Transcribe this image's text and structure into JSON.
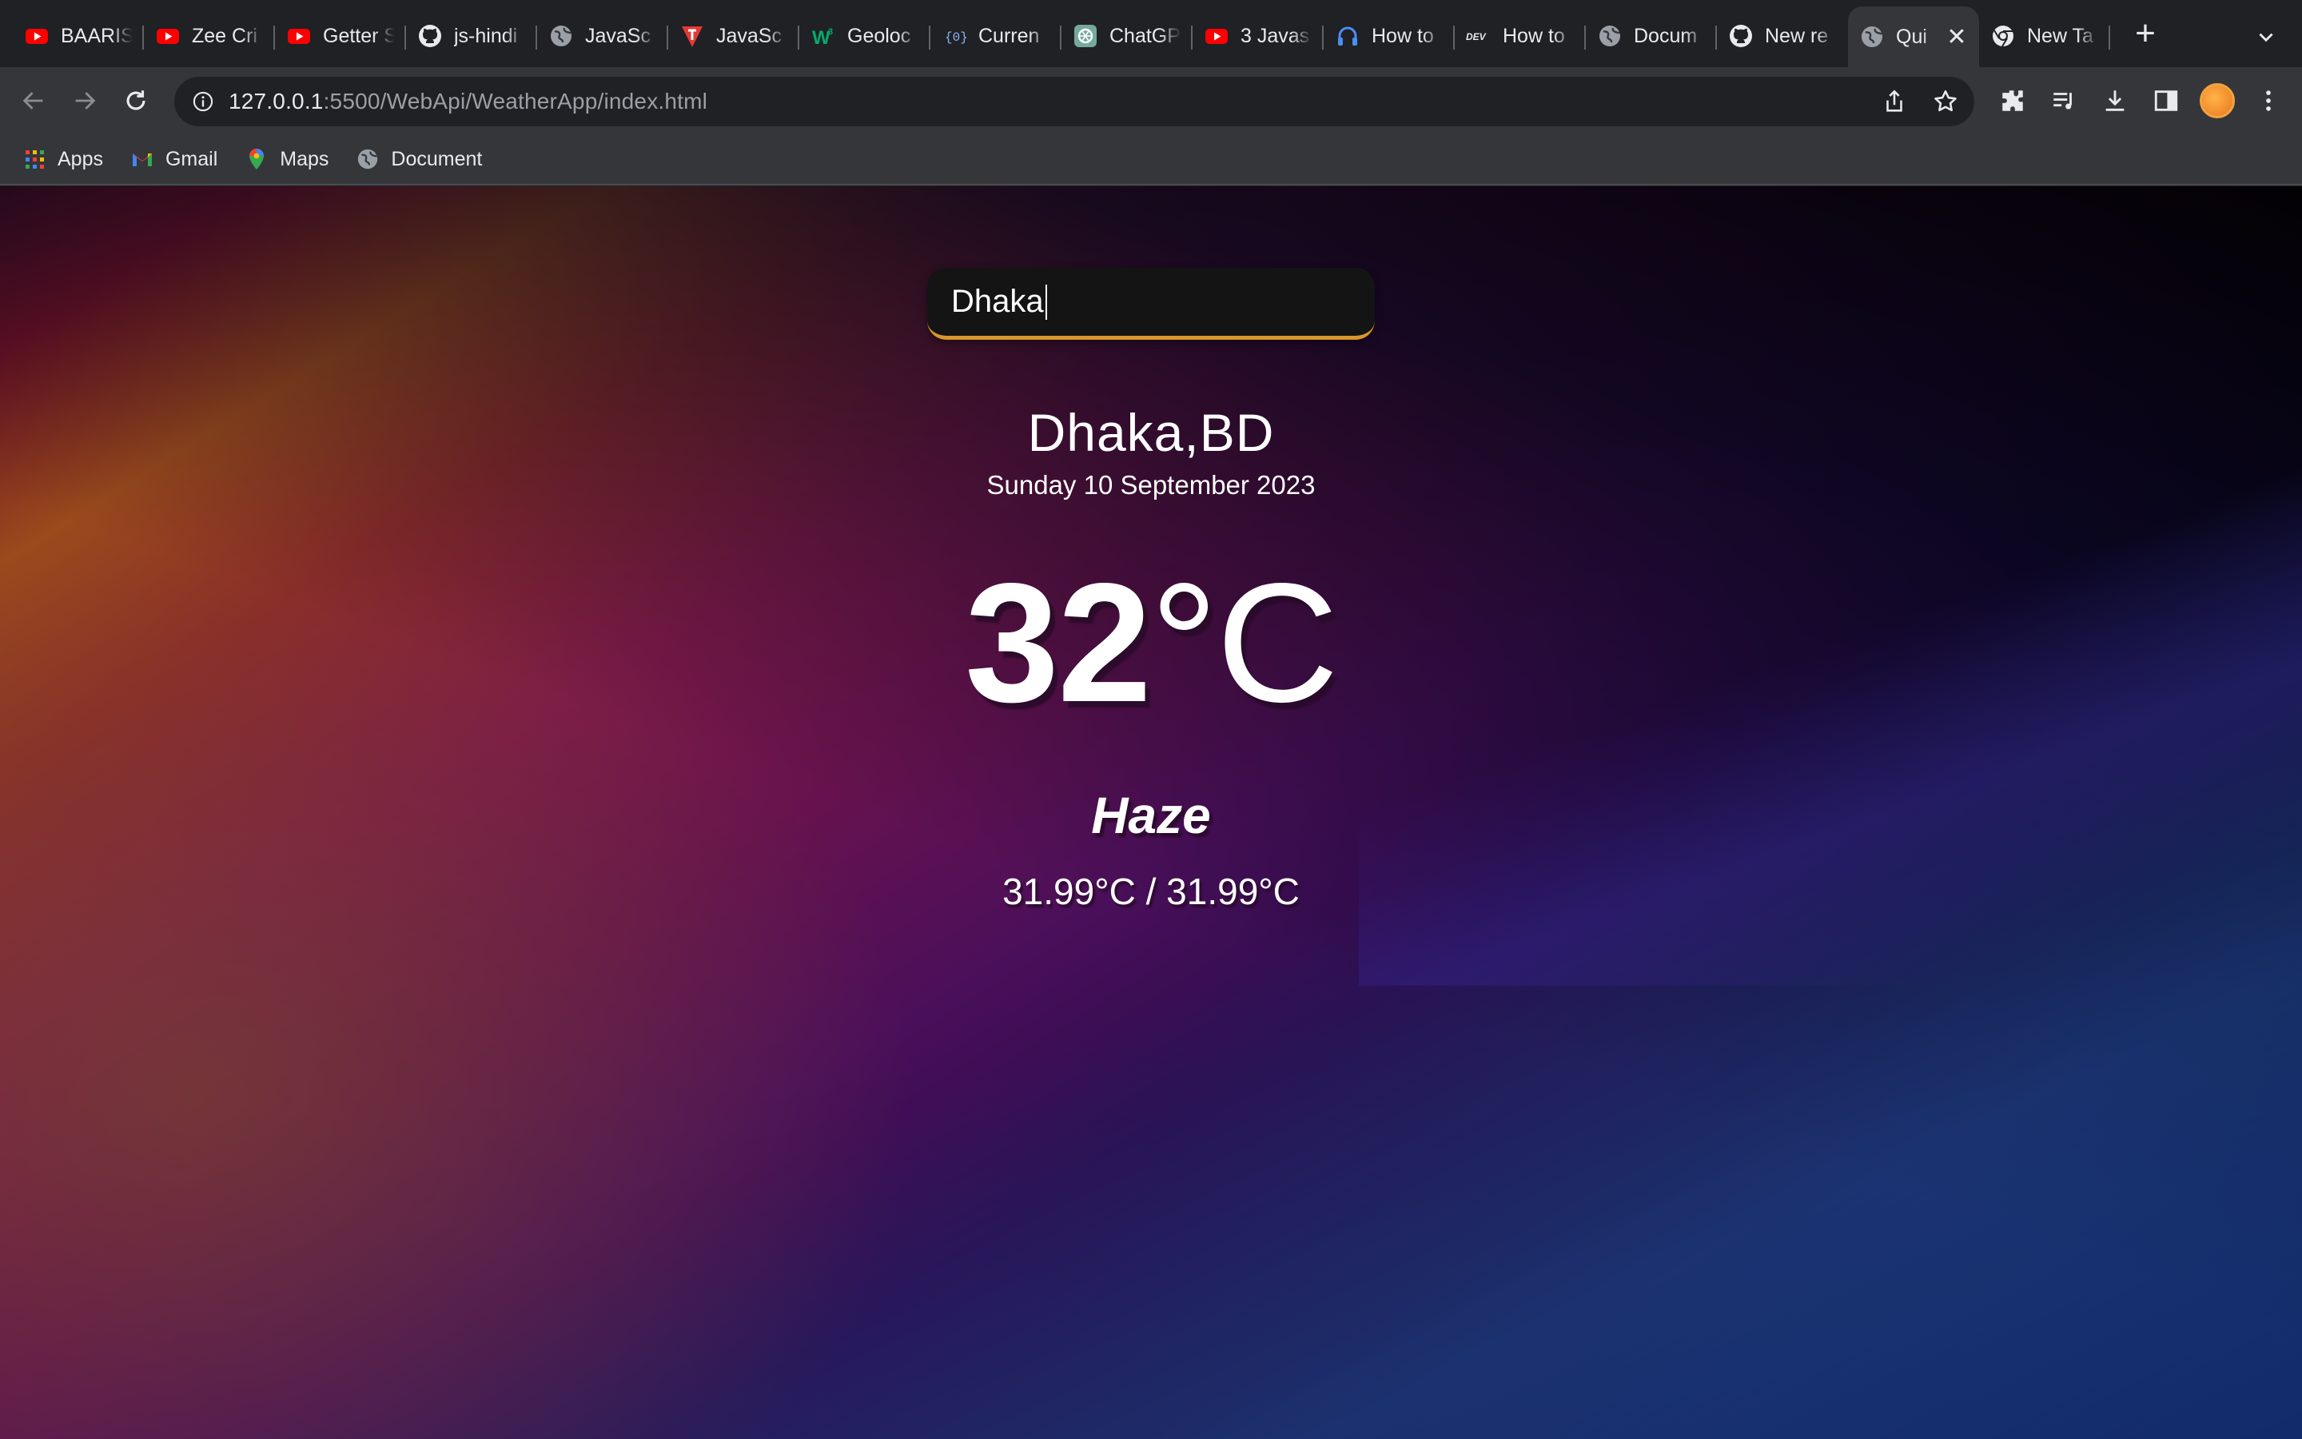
{
  "browser": {
    "tabs": [
      {
        "title": "BAARIS",
        "icon": "youtube-icon"
      },
      {
        "title": "Zee Cri",
        "icon": "youtube-icon"
      },
      {
        "title": "Getter S",
        "icon": "youtube-icon"
      },
      {
        "title": "js-hindi",
        "icon": "github-icon"
      },
      {
        "title": "JavaSc",
        "icon": "globe-icon"
      },
      {
        "title": "JavaSc",
        "icon": "tutorials-icon"
      },
      {
        "title": "Geoloc",
        "icon": "w3schools-icon"
      },
      {
        "title": "Curren",
        "icon": "code-brackets-icon"
      },
      {
        "title": "ChatGP",
        "icon": "chatgpt-icon"
      },
      {
        "title": "3 Javas",
        "icon": "youtube-icon"
      },
      {
        "title": "How to",
        "icon": "headphones-icon"
      },
      {
        "title": "How to",
        "icon": "dev-icon",
        "icon_text": "DEV"
      },
      {
        "title": "Docum",
        "icon": "globe-icon"
      },
      {
        "title": "New re",
        "icon": "github-icon"
      },
      {
        "title": "Qui",
        "icon": "globe-icon",
        "active": true
      },
      {
        "title": "New Ta",
        "icon": "chrome-icon"
      }
    ],
    "url": {
      "host": "127.0.0.1",
      "rest": ":5500/WebApi/WeatherApp/index.html"
    },
    "bookmarks": [
      {
        "label": "Apps",
        "icon": "apps-grid-icon"
      },
      {
        "label": "Gmail",
        "icon": "gmail-icon"
      },
      {
        "label": "Maps",
        "icon": "maps-icon"
      },
      {
        "label": "Document",
        "icon": "globe-icon"
      }
    ],
    "colors": {
      "youtube": "#ff0000",
      "accent_underline": "#d8972b"
    }
  },
  "weather": {
    "search_value": "Dhaka",
    "location": "Dhaka,BD",
    "date": "Sunday 10 September 2023",
    "temperature": "32",
    "temperature_unit": "°C",
    "condition": "Haze",
    "min_max": "31.99°C / 31.99°C"
  }
}
